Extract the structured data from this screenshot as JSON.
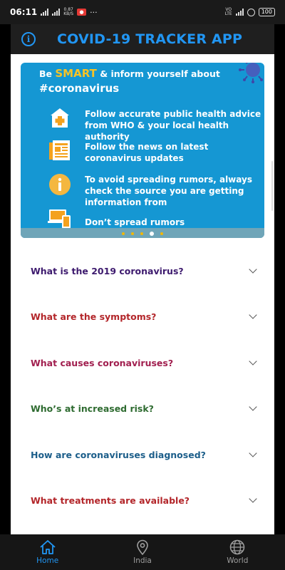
{
  "status": {
    "time": "06:11",
    "net_speed_top": "0.87",
    "net_speed_bottom": "KB/S",
    "volte_top": "VO",
    "volte_bottom": "LTE",
    "battery": "100"
  },
  "app_bar": {
    "title": "COVID-19 TRACKER APP"
  },
  "banner": {
    "head_prefix": "Be",
    "head_smart": "SMART",
    "head_suffix": "& inform yourself about",
    "hashtag": "#coronavirus",
    "tips": [
      {
        "icon": "hospital-icon",
        "text": "Follow accurate public health advice from WHO & your local health authority"
      },
      {
        "icon": "newspaper-icon",
        "text": "Follow the news on latest coronavirus updates"
      },
      {
        "icon": "info-circle-icon",
        "text": "To avoid spreading rumors, always check the source you are getting information from"
      },
      {
        "icon": "devices-icon",
        "text": "Don’t spread rumors"
      }
    ],
    "dots_count": 5,
    "active_dot": 3
  },
  "faq": [
    {
      "question": "What is the 2019 coronavirus?",
      "color": "#3d1a6e"
    },
    {
      "question": "What are the symptoms?",
      "color": "#b3262a"
    },
    {
      "question": "What causes coronaviruses?",
      "color": "#a11f4f"
    },
    {
      "question": "Who’s at increased risk?",
      "color": "#2e6b30"
    },
    {
      "question": "How are coronaviruses diagnosed?",
      "color": "#1c5e8a"
    },
    {
      "question": "What treatments are available?",
      "color": "#b3262a"
    }
  ],
  "nav": [
    {
      "label": "Home",
      "icon": "home-icon",
      "active": true
    },
    {
      "label": "India",
      "icon": "location-pin-icon",
      "active": false
    },
    {
      "label": "World",
      "icon": "globe-icon",
      "active": false
    }
  ],
  "colors": {
    "accent": "#2196f3",
    "banner_bg": "#1597d3",
    "smart": "#f7c326"
  }
}
